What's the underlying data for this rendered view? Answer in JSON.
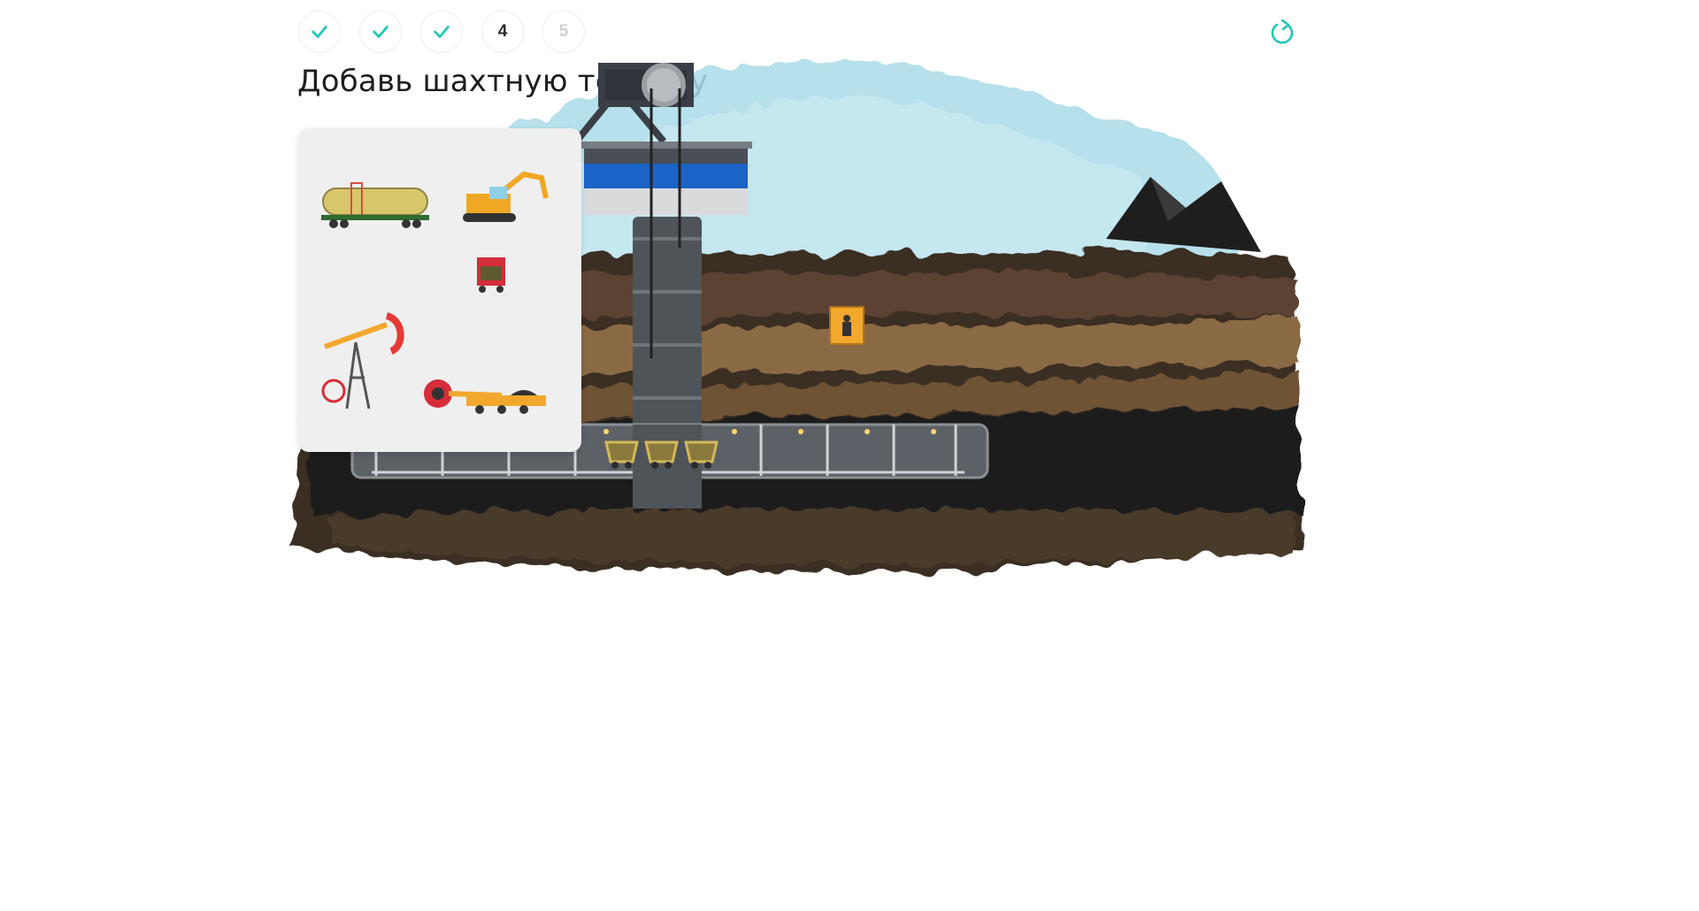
{
  "progress": {
    "steps": [
      {
        "state": "done",
        "icon": "check-icon"
      },
      {
        "state": "done",
        "icon": "check-icon"
      },
      {
        "state": "done",
        "icon": "check-icon"
      },
      {
        "state": "current",
        "label": "4"
      },
      {
        "state": "future",
        "label": "5"
      }
    ]
  },
  "task": {
    "title": "Добавь шахтную технику"
  },
  "toolbar": {
    "reload_icon": "reload-icon"
  },
  "palette": {
    "items": [
      {
        "name": "tank-car-item",
        "icon": "tank-car-icon"
      },
      {
        "name": "excavator-item",
        "icon": "excavator-icon"
      },
      {
        "name": "mine-car-item",
        "icon": "mine-car-icon"
      },
      {
        "name": "pumpjack-item",
        "icon": "pumpjack-icon"
      },
      {
        "name": "bucket-wheel-excavator-item",
        "icon": "bucket-wheel-excavator-icon"
      }
    ]
  },
  "scene": {
    "placed_items": [
      {
        "name": "coal-wagons",
        "icon": "coal-wagons-icon"
      }
    ],
    "elevator": {
      "icon": "miner-elevator-icon"
    }
  },
  "colors": {
    "accent": "#1fc8b4",
    "sky": "#a9dbe8",
    "soil_dark": "#3b2d24",
    "soil_light": "#8a6a45",
    "coal": "#1f1f1f",
    "building_blue": "#1b63c6"
  }
}
